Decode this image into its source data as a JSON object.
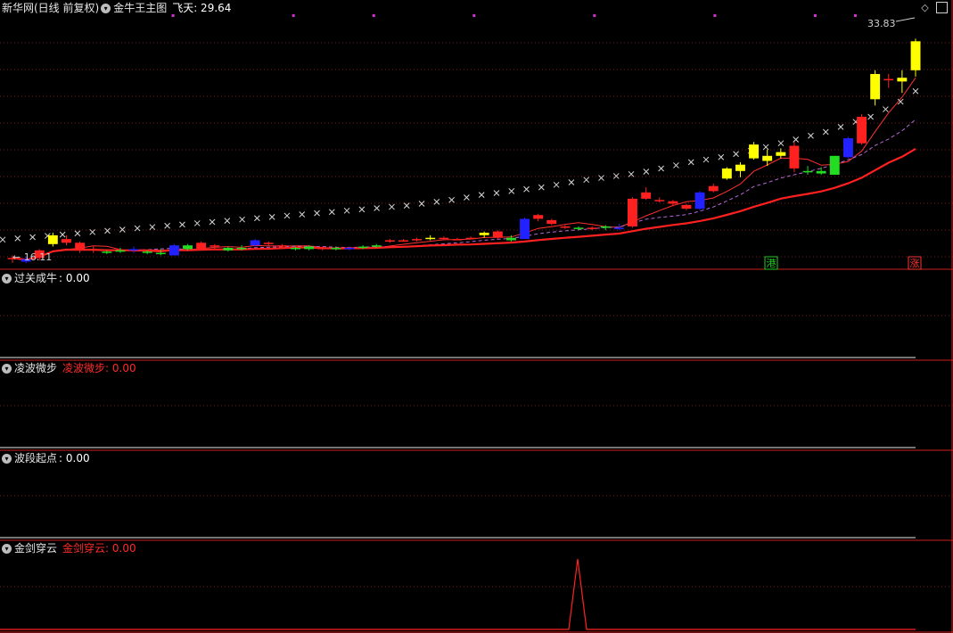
{
  "window": {
    "title": "新华网(日线 前复权)",
    "indicator_name": "金牛王主图",
    "indicator_field": "飞天: 29.64"
  },
  "panels": [
    {
      "label": "过关成牛",
      "value": ": 0.00",
      "secondary": ""
    },
    {
      "label": "凌波微步",
      "value": "",
      "secondary": "凌波微步: 0.00"
    },
    {
      "label": "波段起点",
      "value": ": 0.00",
      "secondary": ""
    },
    {
      "label": "金剑穿云",
      "value": "",
      "secondary": "金剑穿云: 0.00"
    }
  ],
  "icons": {
    "panel_toggle": "chevron-down-icon",
    "corner_diamond": "diamond-icon",
    "corner_box": "window-box-icon"
  },
  "colors": {
    "up": "#ff2020",
    "down": "#22dd22",
    "yellow": "#ffff00",
    "blue": "#2222ff",
    "flyday": "#d8d8d8",
    "magenta": "#cc33cc",
    "divider": "#d02020",
    "grid": "#7a1a1a"
  },
  "chart_data": {
    "type": "candlestick",
    "main_price_range": [
      15.5,
      35.6
    ],
    "high_label": "33.83",
    "low_label": "← 16.11",
    "markers": [
      {
        "bar": 38,
        "text": "港",
        "color": "#22cc22"
      },
      {
        "bar": 45,
        "text": "涨",
        "color": "#ff3333"
      }
    ],
    "magenta_marks": [
      8,
      14,
      18,
      23,
      29,
      35,
      40,
      42
    ],
    "candles": [
      [
        16.3,
        16.6,
        16.0,
        16.4,
        "red"
      ],
      [
        16.3,
        16.5,
        16.0,
        16.1,
        "blue"
      ],
      [
        16.4,
        17.1,
        16.2,
        17.0,
        "red"
      ],
      [
        17.5,
        18.4,
        17.3,
        18.2,
        "yellow"
      ],
      [
        17.9,
        18.2,
        17.4,
        17.6,
        "red"
      ],
      [
        17.6,
        17.7,
        16.8,
        17.0,
        "red"
      ],
      [
        17.1,
        17.3,
        16.8,
        17.0,
        "red"
      ],
      [
        16.9,
        17.0,
        16.7,
        16.8,
        "green"
      ],
      [
        17.0,
        17.2,
        16.8,
        16.9,
        "green"
      ],
      [
        17.0,
        17.3,
        16.8,
        17.1,
        "blue"
      ],
      [
        16.9,
        17.0,
        16.7,
        16.9,
        "green"
      ],
      [
        16.8,
        17.1,
        16.6,
        16.7,
        "green"
      ],
      [
        16.6,
        17.5,
        16.6,
        17.4,
        "blue"
      ],
      [
        17.4,
        17.5,
        17.0,
        17.1,
        "green"
      ],
      [
        17.1,
        17.7,
        17.0,
        17.6,
        "red"
      ],
      [
        17.3,
        17.5,
        17.1,
        17.4,
        "red"
      ],
      [
        17.2,
        17.3,
        16.9,
        17.0,
        "green"
      ],
      [
        17.2,
        17.4,
        17.0,
        17.1,
        "green"
      ],
      [
        17.4,
        17.9,
        17.3,
        17.8,
        "blue"
      ],
      [
        17.6,
        17.7,
        17.4,
        17.5,
        "red"
      ],
      [
        17.4,
        17.5,
        17.2,
        17.3,
        "red"
      ],
      [
        17.2,
        17.3,
        17.0,
        17.1,
        "green"
      ],
      [
        17.3,
        17.4,
        17.0,
        17.1,
        "green"
      ],
      [
        17.2,
        17.3,
        17.0,
        17.1,
        "red"
      ],
      [
        17.2,
        17.3,
        17.0,
        17.1,
        "green"
      ],
      [
        17.1,
        17.3,
        17.0,
        17.2,
        "blue"
      ],
      [
        17.2,
        17.4,
        17.1,
        17.3,
        "green"
      ],
      [
        17.4,
        17.5,
        17.2,
        17.3,
        "green"
      ],
      [
        17.7,
        17.9,
        17.6,
        17.8,
        "red"
      ],
      [
        17.8,
        17.9,
        17.7,
        17.8,
        "red"
      ],
      [
        17.9,
        18.0,
        17.7,
        17.8,
        "red"
      ],
      [
        18.0,
        18.2,
        17.8,
        17.9,
        "yellow"
      ],
      [
        18.0,
        18.1,
        17.8,
        17.9,
        "red"
      ],
      [
        17.9,
        18.0,
        17.8,
        17.9,
        "red"
      ],
      [
        18.0,
        18.1,
        17.9,
        18.0,
        "red"
      ],
      [
        18.2,
        18.5,
        18.0,
        18.4,
        "yellow"
      ],
      [
        18.5,
        18.6,
        17.9,
        18.0,
        "red"
      ],
      [
        17.8,
        18.2,
        17.7,
        18.0,
        "green"
      ],
      [
        17.9,
        19.6,
        17.9,
        19.5,
        "blue"
      ],
      [
        19.5,
        19.9,
        19.3,
        19.8,
        "red"
      ],
      [
        19.4,
        19.5,
        19.0,
        19.1,
        "red"
      ],
      [
        18.9,
        19.0,
        18.7,
        18.9,
        "red"
      ],
      [
        18.8,
        18.9,
        18.6,
        18.7,
        "green"
      ],
      [
        18.7,
        18.9,
        18.6,
        18.8,
        "red"
      ],
      [
        18.8,
        19.0,
        18.6,
        18.9,
        "green"
      ],
      [
        18.7,
        19.1,
        18.6,
        18.8,
        "blue"
      ],
      [
        18.9,
        21.2,
        18.8,
        21.1,
        "red"
      ],
      [
        21.6,
        22.0,
        21.0,
        21.1,
        "red"
      ],
      [
        21.0,
        21.2,
        20.8,
        20.9,
        "red"
      ],
      [
        20.7,
        21.0,
        20.5,
        20.9,
        "red"
      ],
      [
        20.6,
        20.7,
        20.2,
        20.3,
        "red"
      ],
      [
        20.3,
        21.7,
        20.2,
        21.6,
        "blue"
      ],
      [
        21.7,
        22.3,
        21.6,
        22.1,
        "red"
      ],
      [
        22.7,
        23.6,
        22.6,
        23.5,
        "yellow"
      ],
      [
        23.3,
        24.0,
        22.8,
        23.8,
        "yellow"
      ],
      [
        24.3,
        25.6,
        24.2,
        25.4,
        "yellow"
      ],
      [
        24.5,
        25.0,
        23.7,
        24.1,
        "yellow"
      ],
      [
        24.5,
        25.1,
        24.3,
        24.8,
        "yellow"
      ],
      [
        25.3,
        25.6,
        23.2,
        23.5,
        "red"
      ],
      [
        23.2,
        23.7,
        23.0,
        23.3,
        "green"
      ],
      [
        23.3,
        23.6,
        23.0,
        23.1,
        "green"
      ],
      [
        23.0,
        24.5,
        23.0,
        24.5,
        "green"
      ],
      [
        24.4,
        26.0,
        24.3,
        25.9,
        "blue"
      ],
      [
        25.5,
        27.8,
        25.4,
        27.6,
        "red"
      ],
      [
        29.0,
        31.3,
        28.5,
        31.0,
        "yellow"
      ],
      [
        30.6,
        31.0,
        29.9,
        30.6,
        "red"
      ],
      [
        30.4,
        31.3,
        29.5,
        30.7,
        "yellow"
      ],
      [
        31.3,
        33.8,
        30.8,
        33.6,
        "yellow"
      ]
    ],
    "flying_cross_x": [
      17.85,
      17.95,
      18.05,
      18.15,
      18.25,
      18.35,
      18.45,
      18.55,
      18.65,
      18.75,
      18.85,
      18.95,
      19.05,
      19.15,
      19.25,
      19.35,
      19.45,
      19.55,
      19.65,
      19.75,
      19.85,
      19.95,
      20.05,
      20.15,
      20.25,
      20.35,
      20.45,
      20.55,
      20.7,
      20.85,
      21.0,
      21.2,
      21.4,
      21.55,
      21.7,
      21.85,
      22.0,
      22.2,
      22.4,
      22.6,
      22.75,
      22.9,
      23.05,
      23.25,
      23.5,
      23.75,
      24.0,
      24.2,
      24.4,
      24.65,
      24.9,
      25.2,
      25.5,
      25.8,
      26.1,
      26.4,
      26.8,
      27.2,
      27.6,
      28.2,
      28.8,
      29.64
    ],
    "sub_panels": [
      {
        "name": "过关成牛",
        "values": []
      },
      {
        "name": "凌波微步",
        "values": []
      },
      {
        "name": "波段起点",
        "values": []
      },
      {
        "name": "金剑穿云",
        "spike_bar": 51,
        "values": []
      }
    ]
  }
}
